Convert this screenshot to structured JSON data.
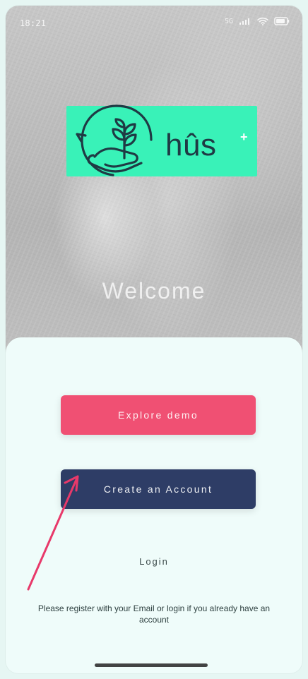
{
  "status_bar": {
    "time": "18:21",
    "signal_label": "5G"
  },
  "brand": {
    "logo_text": "hûs",
    "plus": "+"
  },
  "welcome": {
    "title": "Welcome"
  },
  "actions": {
    "explore_demo": "Explore demo",
    "create_account": "Create an Account",
    "login": "Login"
  },
  "info": {
    "text": "Please register with your Email or login if you already have an account"
  },
  "colors": {
    "accent_teal": "#39f2b8",
    "explore_pink": "#f05073",
    "create_navy": "#2e3d66",
    "card_bg": "#effcfa",
    "annotation_arrow": "#e8396a"
  },
  "icons": {
    "wifi": "wifi-icon",
    "cellular": "cellular-icon",
    "battery": "battery-icon",
    "logo": "hand-plant-logo-icon"
  }
}
